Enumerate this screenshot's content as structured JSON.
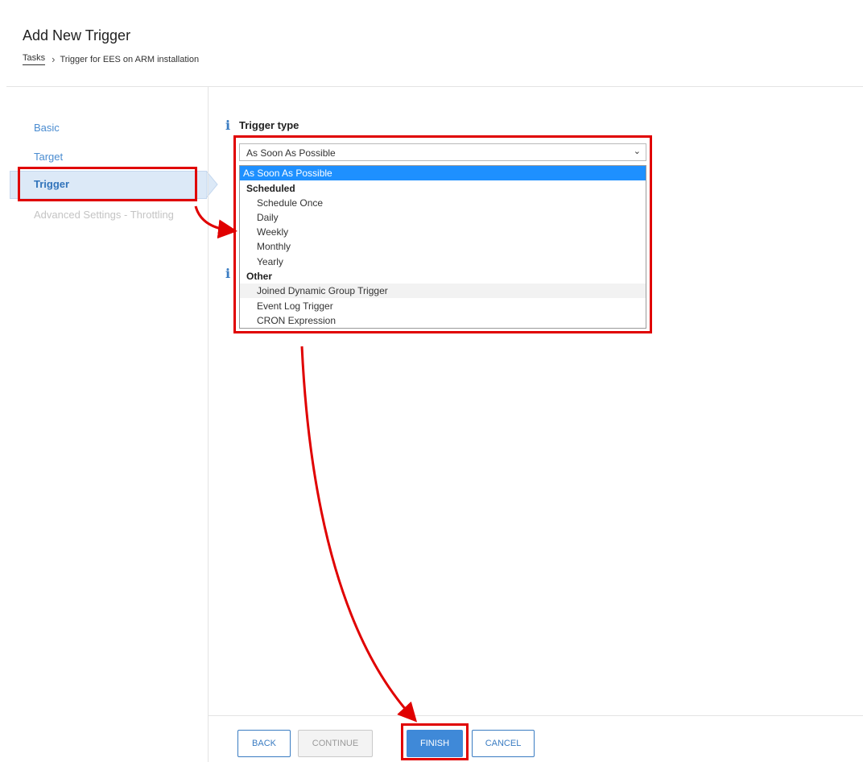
{
  "header": {
    "title": "Add New Trigger",
    "breadcrumb": {
      "root": "Tasks",
      "current": "Trigger for EES on ARM installation"
    }
  },
  "sidebar": {
    "items": [
      {
        "label": "Basic",
        "state": "normal"
      },
      {
        "label": "Target",
        "state": "normal"
      },
      {
        "label": "Trigger",
        "state": "active"
      },
      {
        "label": "Advanced Settings - Throttling",
        "state": "disabled"
      }
    ]
  },
  "trigger": {
    "label": "Trigger type",
    "selected_value": "As Soon As Possible",
    "options": {
      "asap": "As Soon As Possible",
      "scheduled_group": "Scheduled",
      "schedule_once": "Schedule Once",
      "daily": "Daily",
      "weekly": "Weekly",
      "monthly": "Monthly",
      "yearly": "Yearly",
      "other_group": "Other",
      "joined_dynamic": "Joined Dynamic Group Trigger",
      "event_log": "Event Log Trigger",
      "cron": "CRON Expression"
    }
  },
  "footer": {
    "back": "BACK",
    "continue": "CONTINUE",
    "finish": "FINISH",
    "cancel": "CANCEL"
  },
  "colors": {
    "accent": "#3a7cc2",
    "highlight": "#1e90ff",
    "annotation": "#e00000"
  }
}
